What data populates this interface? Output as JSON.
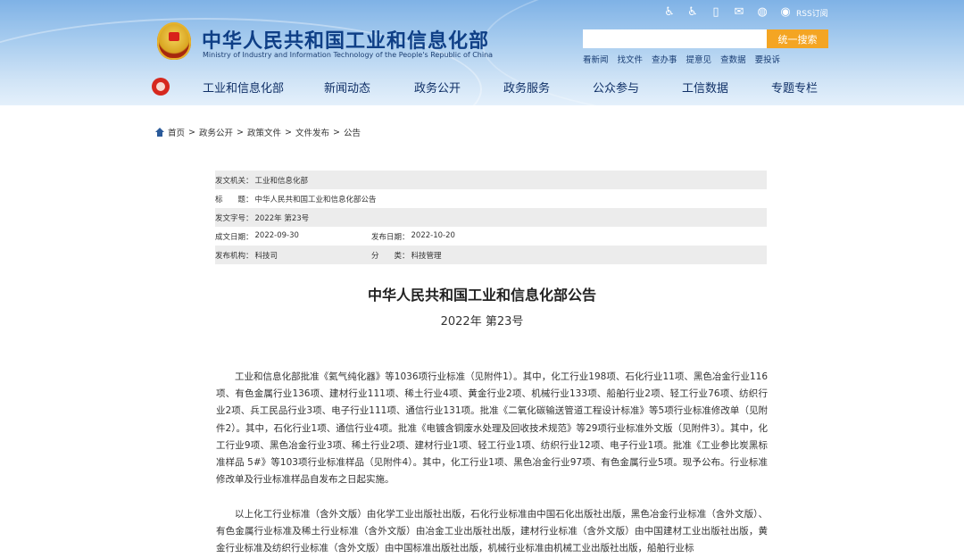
{
  "header": {
    "site_title": "中华人民共和国工业和信息化部",
    "site_subtitle": "Ministry of Industry and Information Technology of the People's Republic of China",
    "rss_label": "RSS订阅",
    "search": {
      "placeholder": "",
      "button_label": "统一搜索"
    },
    "quick_links": [
      "看新闻",
      "找文件",
      "查办事",
      "提意见",
      "查数据",
      "要投诉"
    ],
    "nav_items": [
      "工业和信息化部",
      "新闻动态",
      "政务公开",
      "政务服务",
      "公众参与",
      "工信数据",
      "专题专栏"
    ]
  },
  "breadcrumb": {
    "items": [
      "首页",
      "政务公开",
      "政策文件",
      "文件发布",
      "公告"
    ],
    "separator": ">"
  },
  "meta": {
    "issuer_label": "发文机关：",
    "issuer": "工业和信息化部",
    "title_label": "标　　题：",
    "title": "中华人民共和国工业和信息化部公告",
    "doc_no_label": "发文字号：",
    "doc_no": "2022年 第23号",
    "created_label": "成文日期：",
    "created": "2022-09-30",
    "published_label": "发布日期：",
    "published": "2022-10-20",
    "org_label": "发布机构：",
    "org": "科技司",
    "category_label": "分　　类：",
    "category": "科技管理"
  },
  "document": {
    "title": "中华人民共和国工业和信息化部公告",
    "subtitle": "2022年 第23号",
    "paragraphs": [
      "工业和信息化部批准《氦气纯化器》等1036项行业标准（见附件1）。其中，化工行业198项、石化行业11项、黑色冶金行业116项、有色金属行业136项、建材行业111项、稀土行业4项、黄金行业2项、机械行业133项、船舶行业2项、轻工行业76项、纺织行业2项、兵工民品行业3项、电子行业111项、通信行业131项。批准《二氧化碳输送管道工程设计标准》等5项行业标准修改单（见附件2）。其中，石化行业1项、通信行业4项。批准《电镀含铜废水处理及回收技术规范》等29项行业标准外文版（见附件3）。其中，化工行业9项、黑色冶金行业3项、稀土行业2项、建材行业1项、轻工行业1项、纺织行业12项、电子行业1项。批准《工业参比炭黑标准样品 5#》等103项行业标准样品（见附件4）。其中，化工行业1项、黑色冶金行业97项、有色金属行业5项。现予公布。行业标准修改单及行业标准样品自发布之日起实施。",
      "以上化工行业标准（含外文版）由化学工业出版社出版，石化行业标准由中国石化出版社出版，黑色冶金行业标准（含外文版）、有色金属行业标准及稀土行业标准（含外文版）由冶金工业出版社出版，建材行业标准（含外文版）由中国建材工业出版社出版，黄金行业标准及纺织行业标准（含外文版）由中国标准出版社出版，机械行业标准由机械工业出版社出版，船舶行业标"
    ]
  },
  "colors": {
    "header_top": "#7fb2e6",
    "title_blue": "#0f3f86",
    "search_button": "#f4a523",
    "meta_shade": "#ececec"
  },
  "icons": [
    "accessibility-icon",
    "wheelchair-icon",
    "mobile-icon",
    "mail-icon",
    "wechat-icon",
    "weibo-icon",
    "home-icon"
  ]
}
